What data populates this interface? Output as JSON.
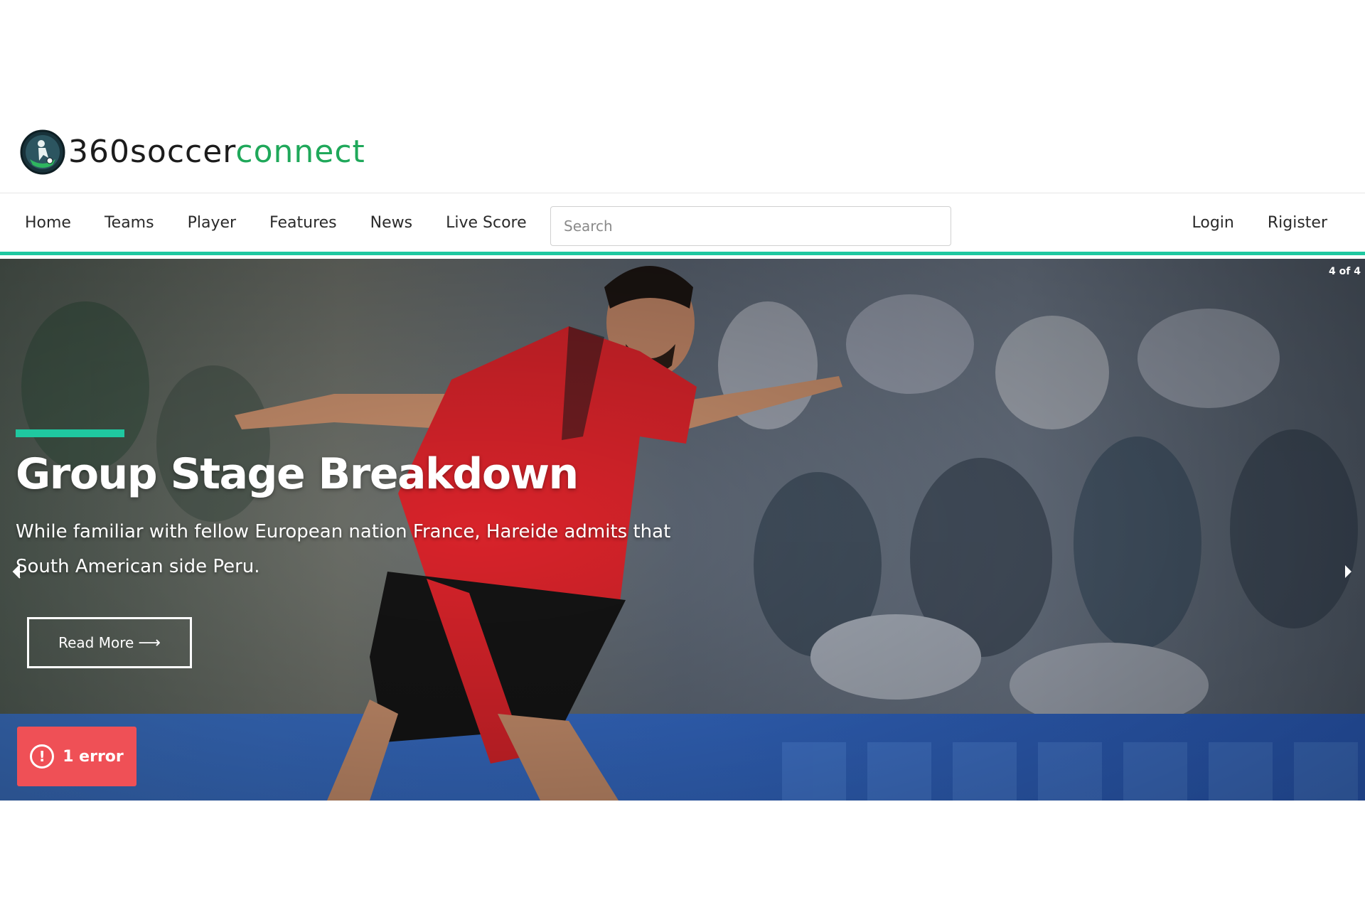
{
  "logo": {
    "text_primary": "360soccer",
    "text_secondary": "connect",
    "icon": "soccer-ball-logo-icon"
  },
  "nav": {
    "items": [
      {
        "label": "Home"
      },
      {
        "label": "Teams"
      },
      {
        "label": "Player"
      },
      {
        "label": "Features"
      },
      {
        "label": "News"
      },
      {
        "label": "Live Score"
      }
    ],
    "search": {
      "placeholder": "Search",
      "value": ""
    },
    "login_label": "Login",
    "register_label": "Rigister"
  },
  "hero": {
    "counter": "4 of 4",
    "title": "Group Stage Breakdown",
    "description": "While familiar with fellow European nation France, Hareide admits that South American side Peru.",
    "read_more_label": "Read More",
    "read_more_icon": "arrow-right-icon",
    "prev_icon": "chevron-left-icon",
    "next_icon": "chevron-right-icon"
  },
  "error_badge": {
    "label": "1 error",
    "icon_glyph": "!"
  },
  "colors": {
    "accent": "#1fc8a0",
    "logo_green": "#1fa85a",
    "error_red": "#ef5056",
    "jersey_red": "#d8232a"
  }
}
